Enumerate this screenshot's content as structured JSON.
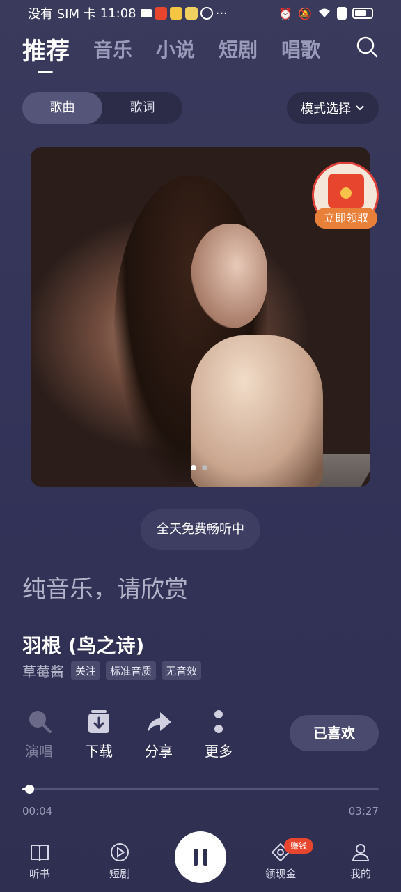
{
  "status_bar": {
    "carrier": "没有 SIM 卡",
    "time": "11:08",
    "dots": "···"
  },
  "top_nav": {
    "tabs": [
      "推荐",
      "音乐",
      "小说",
      "短剧",
      "唱歌"
    ],
    "active_tab": 0
  },
  "segment": {
    "options": [
      "歌曲",
      "歌词"
    ],
    "active": 0
  },
  "mode_select": {
    "label": "模式选择"
  },
  "cover": {
    "page_count": 2,
    "active_page": 0
  },
  "redpack": {
    "label": "立即领取"
  },
  "free_pill": {
    "label": "全天免费畅听中"
  },
  "pure_music": "纯音乐，请欣赏",
  "song": {
    "title": "羽根 (鸟之诗)",
    "artist": "草莓酱",
    "tags": [
      "关注",
      "标准音质",
      "无音效"
    ]
  },
  "actions": [
    {
      "label": "演唱",
      "icon": "mic-icon",
      "enabled": false
    },
    {
      "label": "下载",
      "icon": "download-icon",
      "enabled": true
    },
    {
      "label": "分享",
      "icon": "share-icon",
      "enabled": true
    },
    {
      "label": "更多",
      "icon": "more-icon",
      "enabled": true
    }
  ],
  "liked_button": {
    "label": "已喜欢"
  },
  "playback": {
    "current_time": "00:04",
    "total_time": "03:27",
    "progress_fraction": 0.019
  },
  "bottom_nav": {
    "items": [
      {
        "label": "听书",
        "icon": "book-icon"
      },
      {
        "label": "短剧",
        "icon": "video-play-icon"
      },
      {
        "label": "领现金",
        "icon": "coin-icon",
        "badge": "赚钱"
      },
      {
        "label": "我的",
        "icon": "profile-icon"
      }
    ],
    "center_icon": "pause-icon"
  }
}
